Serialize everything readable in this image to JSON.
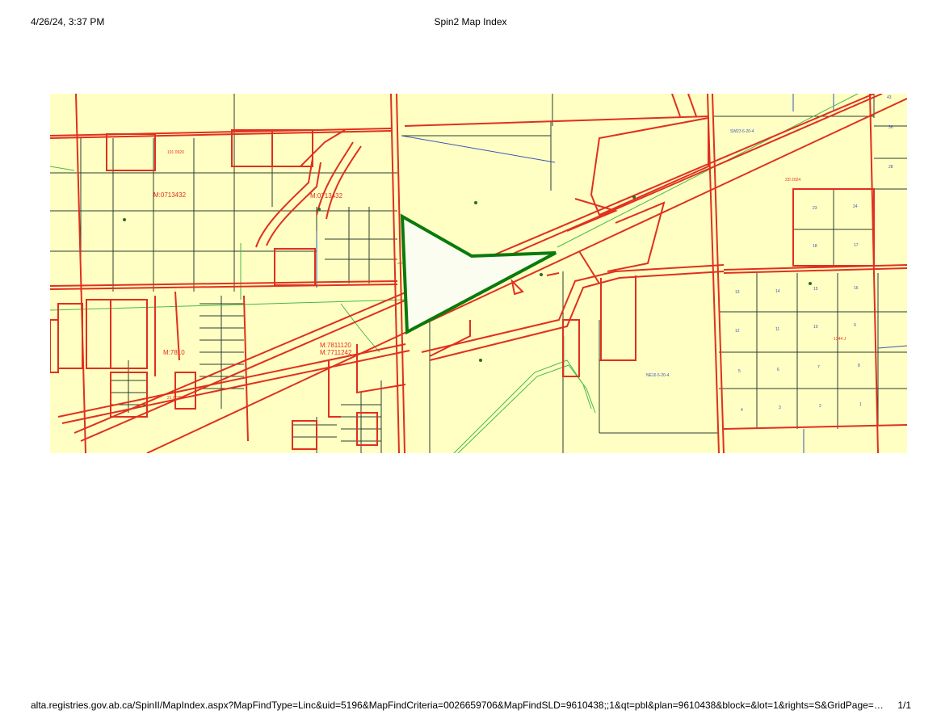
{
  "header": {
    "datetime": "4/26/24, 3:37 PM",
    "title": "Spin2 Map Index"
  },
  "footer": {
    "url": "alta.registries.gov.ab.ca/SpinII/MapIndex.aspx?MapFindType=Linc&uid=5196&MapFindCriteria=0026659706&MapFindSLD=9610438;;1&qt=pbl&plan=9610438&block=&lot=1&rights=S&GridPage=0&b…",
    "page": "1/1"
  },
  "map": {
    "colors": {
      "background": "#ffffc4",
      "parcel_line": "#e0301e",
      "lot_line": "#2b3d2b",
      "highlight": "#0a7a0a",
      "highlight_fill": "#fbfdf0",
      "blue_line": "#3a55b8",
      "green_line": "#49b84a"
    },
    "labels": [
      {
        "text": "M:0713432",
        "kind": "red"
      },
      {
        "text": "M:0713432",
        "kind": "red"
      },
      {
        "text": "M:7811120",
        "kind": "red"
      },
      {
        "text": "M:7711242",
        "kind": "red"
      },
      {
        "text": "M:7810",
        "kind": "red"
      },
      {
        "text": "SW23 6-20-4",
        "kind": "blue"
      },
      {
        "text": "NE16 6-20-4",
        "kind": "blue"
      },
      {
        "text": "22l 2024",
        "kind": "red"
      },
      {
        "text": "13",
        "kind": "blue"
      },
      {
        "text": "14",
        "kind": "blue"
      },
      {
        "text": "15",
        "kind": "blue"
      },
      {
        "text": "16",
        "kind": "blue"
      },
      {
        "text": "17",
        "kind": "blue"
      },
      {
        "text": "18",
        "kind": "blue"
      },
      {
        "text": "23",
        "kind": "blue"
      },
      {
        "text": "24",
        "kind": "blue"
      },
      {
        "text": "12",
        "kind": "blue"
      },
      {
        "text": "11",
        "kind": "blue"
      },
      {
        "text": "10",
        "kind": "blue"
      },
      {
        "text": "9",
        "kind": "blue"
      },
      {
        "text": "5",
        "kind": "blue"
      },
      {
        "text": "6",
        "kind": "blue"
      },
      {
        "text": "7",
        "kind": "blue"
      },
      {
        "text": "8",
        "kind": "blue"
      },
      {
        "text": "4",
        "kind": "blue"
      },
      {
        "text": "3",
        "kind": "blue"
      },
      {
        "text": "2",
        "kind": "blue"
      },
      {
        "text": "1",
        "kind": "blue"
      },
      {
        "text": "43",
        "kind": "blue"
      },
      {
        "text": "36",
        "kind": "blue"
      },
      {
        "text": "28",
        "kind": "blue"
      },
      {
        "text": "191 0920",
        "kind": "red"
      },
      {
        "text": "21 0025",
        "kind": "red"
      },
      {
        "text": "1344 J",
        "kind": "red"
      }
    ]
  }
}
